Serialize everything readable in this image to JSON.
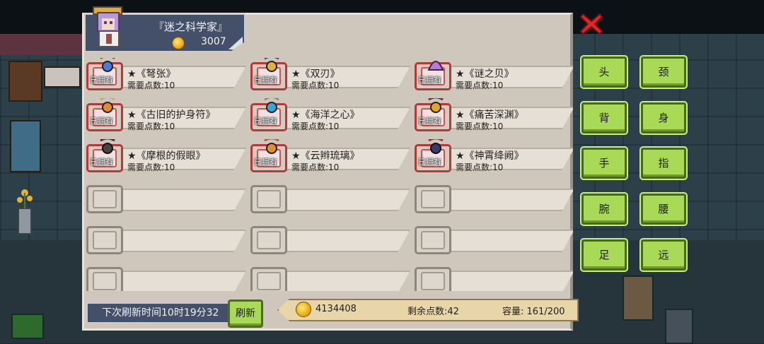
{
  "shop": {
    "merchant_name": "『迷之科学家』",
    "merchant_coins": "3007"
  },
  "items": [
    {
      "name": "★《弩张》",
      "cost": "需要点数:10",
      "owned": true,
      "owned_label": "已拥有",
      "gem": "#4a7bd6"
    },
    {
      "name": "★《双刃》",
      "cost": "需要点数:10",
      "owned": true,
      "owned_label": "已拥有",
      "gem": "#e0b13b"
    },
    {
      "name": "★《谜之贝》",
      "cost": "需要点数:10",
      "owned": true,
      "owned_label": "已拥有",
      "gem": "#b77ad6"
    },
    {
      "name": "★《古旧的护身符》",
      "cost": "需要点数:10",
      "owned": true,
      "owned_label": "已拥有",
      "gem": "#e58a2e"
    },
    {
      "name": "★《海洋之心》",
      "cost": "需要点数:10",
      "owned": true,
      "owned_label": "已拥有",
      "gem": "#3aa6d6"
    },
    {
      "name": "★《痛苦深渊》",
      "cost": "需要点数:10",
      "owned": true,
      "owned_label": "已拥有",
      "gem": "#e6a321"
    },
    {
      "name": "★《摩根的假眼》",
      "cost": "需要点数:10",
      "owned": true,
      "owned_label": "已拥有",
      "gem": "#444444"
    },
    {
      "name": "★《云辫琉璃》",
      "cost": "需要点数:10",
      "owned": true,
      "owned_label": "已拥有",
      "gem": "#e0902e"
    },
    {
      "name": "★《神霄绛阙》",
      "cost": "需要点数:10",
      "owned": true,
      "owned_label": "已拥有",
      "gem": "#3b3b6a"
    }
  ],
  "footer": {
    "refresh_timer": "下次刷新时间10时19分32",
    "refresh_button": "刷新",
    "coins": "4134408",
    "points_remaining": "剩余点数:42",
    "capacity": "容量: 161/200"
  },
  "categories": [
    "头",
    "颈",
    "背",
    "身",
    "手",
    "指",
    "腕",
    "腰",
    "足",
    "远"
  ],
  "colors": {
    "panel": "#cfc7bb",
    "title_tab": "#44506a",
    "button_green": "#a8d957",
    "owned_red": "#b13a3a",
    "close_red": "#e2262e"
  }
}
